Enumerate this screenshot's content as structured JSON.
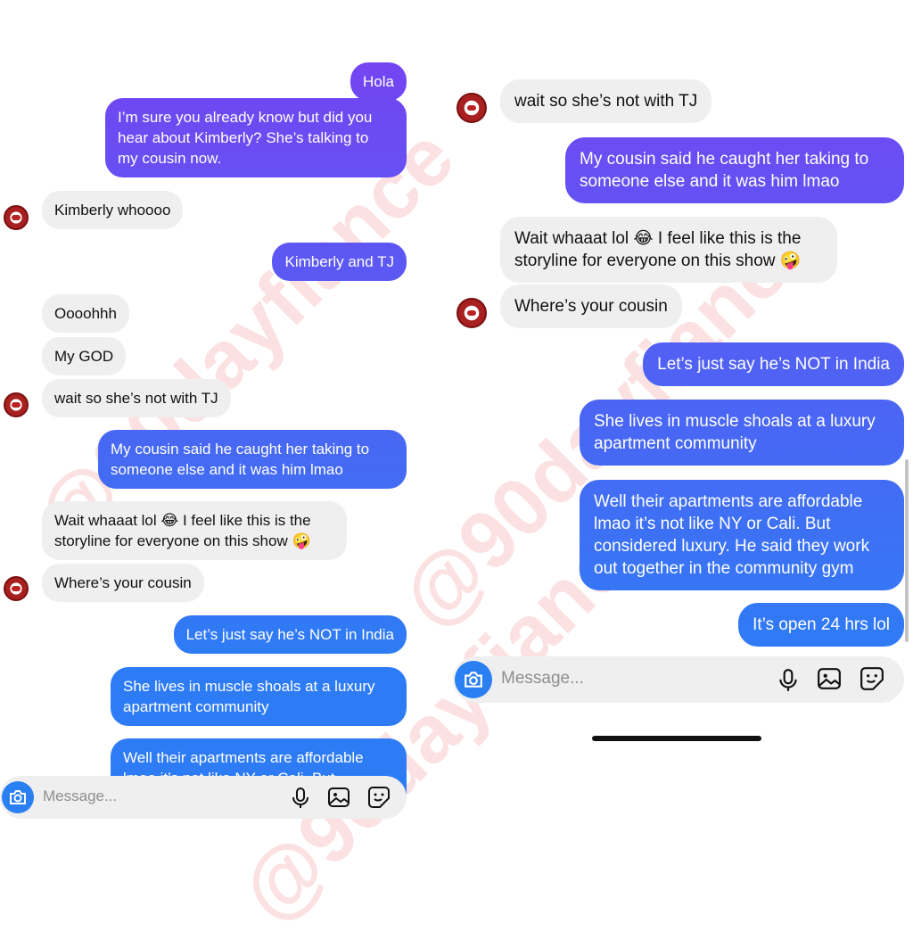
{
  "left": {
    "messages": [
      {
        "text": "Hola",
        "dir": "out"
      },
      {
        "text": "I’m sure you already know but did you\nhear about Kimberly? She’s talking to\nmy cousin now.",
        "dir": "out"
      },
      {
        "text": "Kimberly whoooo",
        "dir": "in"
      },
      {
        "text": "Kimberly and TJ",
        "dir": "out"
      },
      {
        "text": "Oooohhh",
        "dir": "in"
      },
      {
        "text": "My GOD",
        "dir": "in"
      },
      {
        "text": "wait so she’s not with TJ",
        "dir": "in"
      },
      {
        "text": "My cousin said he caught her taking to\nsomeone else and it was him lmao",
        "dir": "out"
      },
      {
        "text": "Wait whaaat lol 😂 I feel like this is the\nstoryline for everyone on this show 🤪",
        "dir": "in"
      },
      {
        "text": "Where’s your cousin",
        "dir": "in"
      },
      {
        "text": "Let’s just say he’s NOT in India",
        "dir": "out"
      },
      {
        "text": "She lives in muscle shoals at a luxury\napartment community",
        "dir": "out"
      },
      {
        "text": "Well their apartments are affordable\nlmao it’s not like NY or Cali. But",
        "dir": "out"
      }
    ],
    "composer": {
      "placeholder": "Message..."
    }
  },
  "right": {
    "messages": [
      {
        "text": "wait so she’s not with TJ",
        "dir": "in"
      },
      {
        "text": "My cousin said he caught her taking to\nsomeone else and it was him lmao",
        "dir": "out"
      },
      {
        "text": "Wait whaaat lol 😂 I feel like this is the\nstoryline for everyone on this show 🤪",
        "dir": "in"
      },
      {
        "text": "Where’s your cousin",
        "dir": "in"
      },
      {
        "text": "Let’s just say he’s NOT in India",
        "dir": "out"
      },
      {
        "text": "She lives in muscle shoals at a luxury\napartment community",
        "dir": "out"
      },
      {
        "text": "Well their apartments are affordable\nlmao it’s not like NY or Cali. But\nconsidered luxury. He said they work\nout together in the community gym",
        "dir": "out"
      },
      {
        "text": "It’s open 24 hrs lol",
        "dir": "out"
      }
    ],
    "composer": {
      "placeholder": "Message..."
    }
  },
  "watermark": "@90dayfiance",
  "colors": {
    "bubble_top": "#7b3ff2",
    "bubble_bottom": "#2e7cf5",
    "incoming": "#efefef",
    "camera": "#2a7ff2"
  }
}
